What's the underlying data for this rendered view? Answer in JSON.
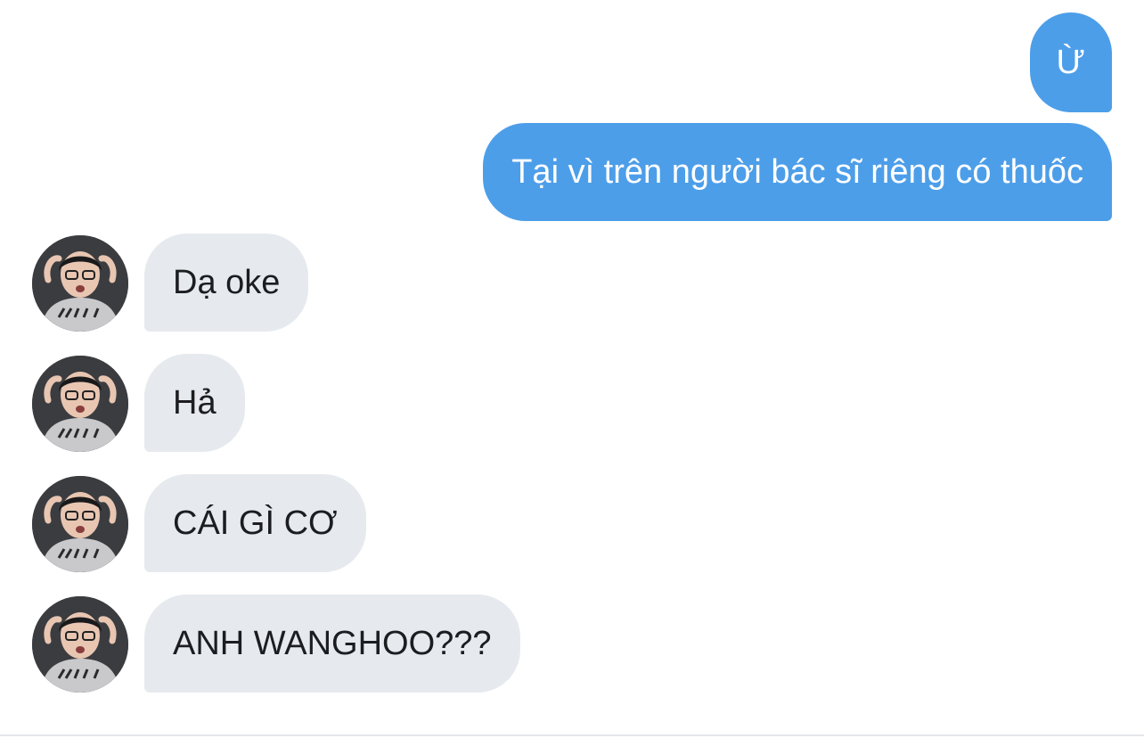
{
  "conversation": {
    "messages": [
      {
        "direction": "outgoing",
        "text": "Ừ"
      },
      {
        "direction": "outgoing",
        "text": "Tại vì trên người bác sĩ riêng có thuốc"
      },
      {
        "direction": "incoming",
        "text": "Dạ oke",
        "avatar": "contact-avatar"
      },
      {
        "direction": "incoming",
        "text": "Hả",
        "avatar": "contact-avatar"
      },
      {
        "direction": "incoming",
        "text": "CÁI GÌ CƠ",
        "avatar": "contact-avatar"
      },
      {
        "direction": "incoming",
        "text": "ANH WANGHOO???",
        "avatar": "contact-avatar"
      }
    ],
    "colors": {
      "outgoing_bubble": "#4d9ee9",
      "incoming_bubble": "#e6eaee",
      "outgoing_text": "#ffffff",
      "incoming_text": "#1c1d20"
    }
  }
}
